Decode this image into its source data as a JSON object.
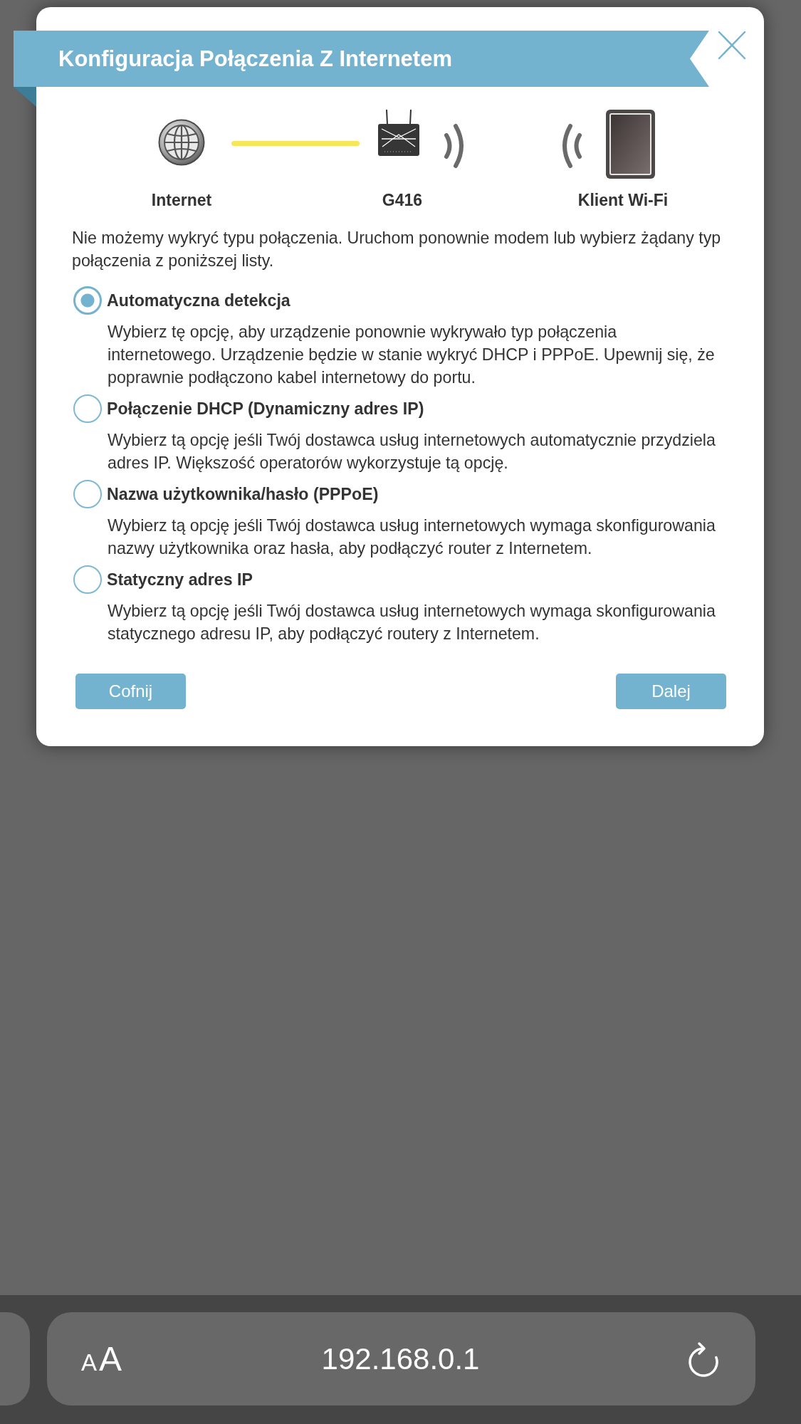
{
  "dialog": {
    "title": "Konfiguracja Połączenia Z Internetem",
    "devices": [
      {
        "kind": "globe",
        "label": "Internet"
      },
      {
        "kind": "router",
        "label": "G416"
      },
      {
        "kind": "tablet",
        "label": "Klient Wi-Fi"
      }
    ],
    "message": "Nie możemy wykryć typu połączenia. Uruchom ponownie modem lub wybierz żądany typ połączenia z poniższej listy.",
    "options": [
      {
        "title": "Automatyczna detekcja",
        "description": "Wybierz tę opcję, aby urządzenie ponownie wykrywało typ połączenia internetowego. Urządzenie będzie w stanie wykryć DHCP i PPPoE. Upewnij się, że poprawnie podłączono kabel internetowy do portu.",
        "selected": true
      },
      {
        "title": "Połączenie DHCP (Dynamiczny adres IP)",
        "description": "Wybierz tą opcję jeśli Twój dostawca usług internetowych automatycznie przydziela adres IP. Większość operatorów wykorzystuje tą opcję.",
        "selected": false
      },
      {
        "title": "Nazwa użytkownika/hasło (PPPoE)",
        "description": "Wybierz tą opcję jeśli Twój dostawca usług internetowych wymaga skonfigurowania nazwy użytkownika oraz hasła, aby podłączyć router z Internetem.",
        "selected": false
      },
      {
        "title": "Statyczny adres IP",
        "description": "Wybierz tą opcję jeśli Twój dostawca usług internetowych wymaga skonfigurowania statycznego adresu IP, aby podłączyć routery z Internetem.",
        "selected": false
      }
    ],
    "buttons": [
      {
        "label": "Cofnij"
      },
      {
        "label": "Dalej"
      }
    ]
  },
  "browser_bar": {
    "text_size_button": {
      "small_letter": "A",
      "large_letter": "A"
    },
    "address": "192.168.0.1"
  }
}
